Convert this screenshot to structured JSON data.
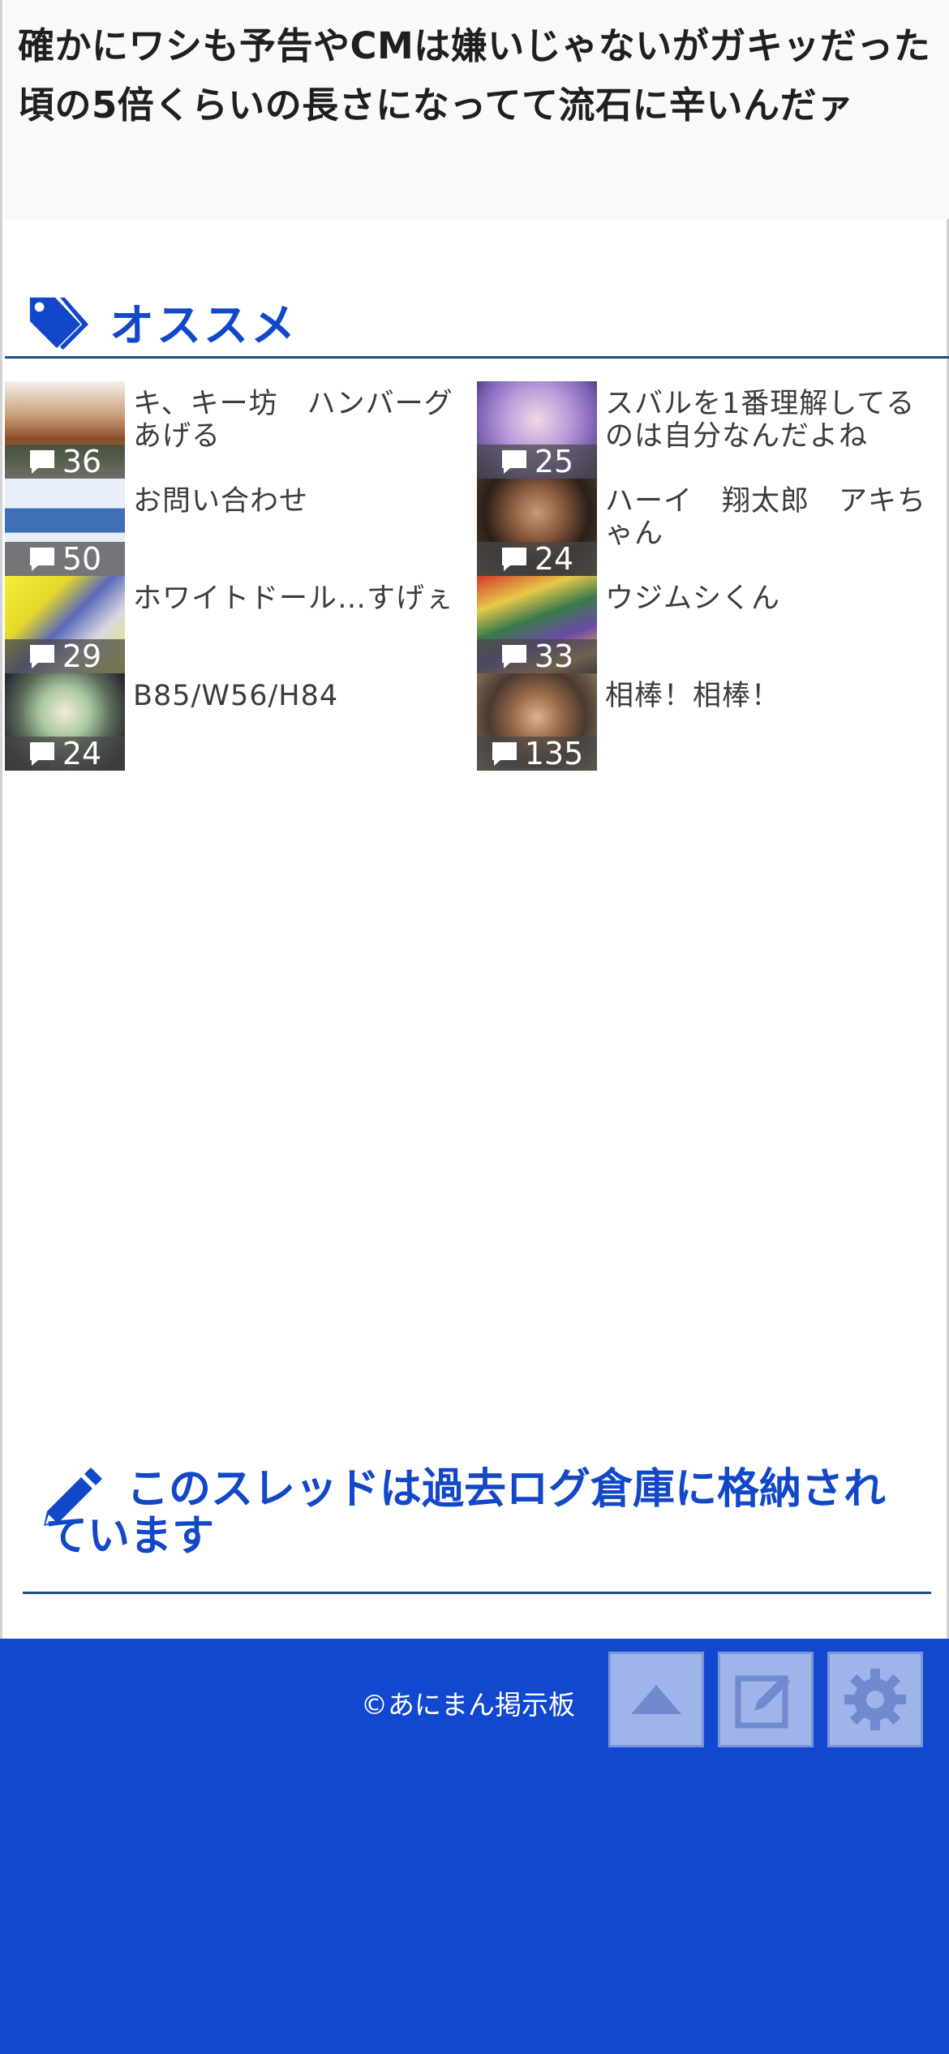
{
  "post": {
    "text": "確かにワシも予告やCMは嫌いじゃないがガキッだった頃の5倍くらいの長さになってて流石に辛いんだァ"
  },
  "recommend": {
    "heading": "オススメ",
    "icon": "tag-icon",
    "accent": "#1248c8",
    "items": [
      {
        "title": "キ、キー坊　ハンバーグあげる",
        "count": "36",
        "thumb": "food-okonomiyaki"
      },
      {
        "title": "スバルを1番理解してるのは自分なんだよね",
        "count": "25",
        "thumb": "purple-hair-character"
      },
      {
        "title": "お問い合わせ",
        "count": "50",
        "thumb": "site-logo-anim"
      },
      {
        "title": "ハーイ　翔太郎　アキちゃん",
        "count": "24",
        "thumb": "dark-haired-person"
      },
      {
        "title": "ホワイトドール…すげぇ",
        "count": "29",
        "thumb": "mecha-robot"
      },
      {
        "title": "ウジムシくん",
        "count": "33",
        "thumb": "manga-cover"
      },
      {
        "title": "B85/W56/H84",
        "count": "24",
        "thumb": "anime-girl"
      },
      {
        "title": "相棒！相棒！",
        "count": "135",
        "thumb": "goggles-woman"
      }
    ]
  },
  "archive": {
    "message": "このスレッドは過去ログ倉庫に格納されています",
    "icon": "pencil-icon"
  },
  "footer": {
    "copyright": "©あにまん掲示板",
    "background": "#1248cf",
    "buttons": [
      {
        "name": "scroll-top",
        "icon": "triangle-up-icon"
      },
      {
        "name": "write-post",
        "icon": "edit-icon"
      },
      {
        "name": "settings",
        "icon": "gear-icon"
      }
    ]
  }
}
